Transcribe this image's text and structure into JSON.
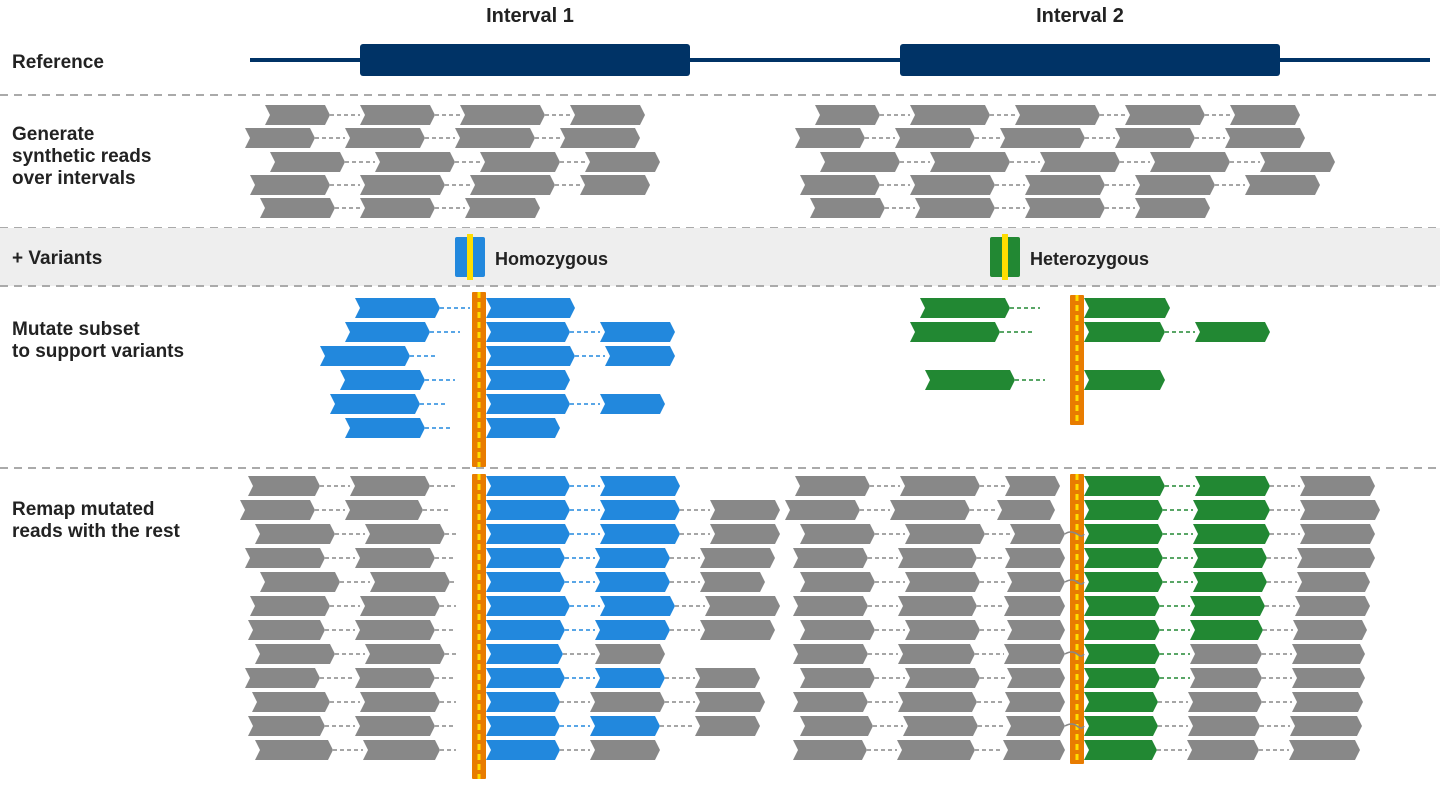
{
  "labels": {
    "reference": "Reference",
    "generate": "Generate\nsynthetic reads\nover intervals",
    "variants": "+ Variants",
    "mutate": "Mutate subset\nto support variants",
    "remap": "Remap mutated\nreads with the rest"
  },
  "intervals": {
    "interval1": "Interval 1",
    "interval2": "Interval 2"
  },
  "legend": {
    "homozygous": "Homozygous",
    "heterozygous": "Heterozygous"
  },
  "colors": {
    "navy": "#003366",
    "gray_read": "#888888",
    "blue_read": "#2288dd",
    "green_read": "#228833",
    "orange_variant": "#e87c00",
    "yellow_variant": "#ffdd00",
    "light_gray_bg": "#eeeeee",
    "dashed_line": "#aaaaaa"
  }
}
